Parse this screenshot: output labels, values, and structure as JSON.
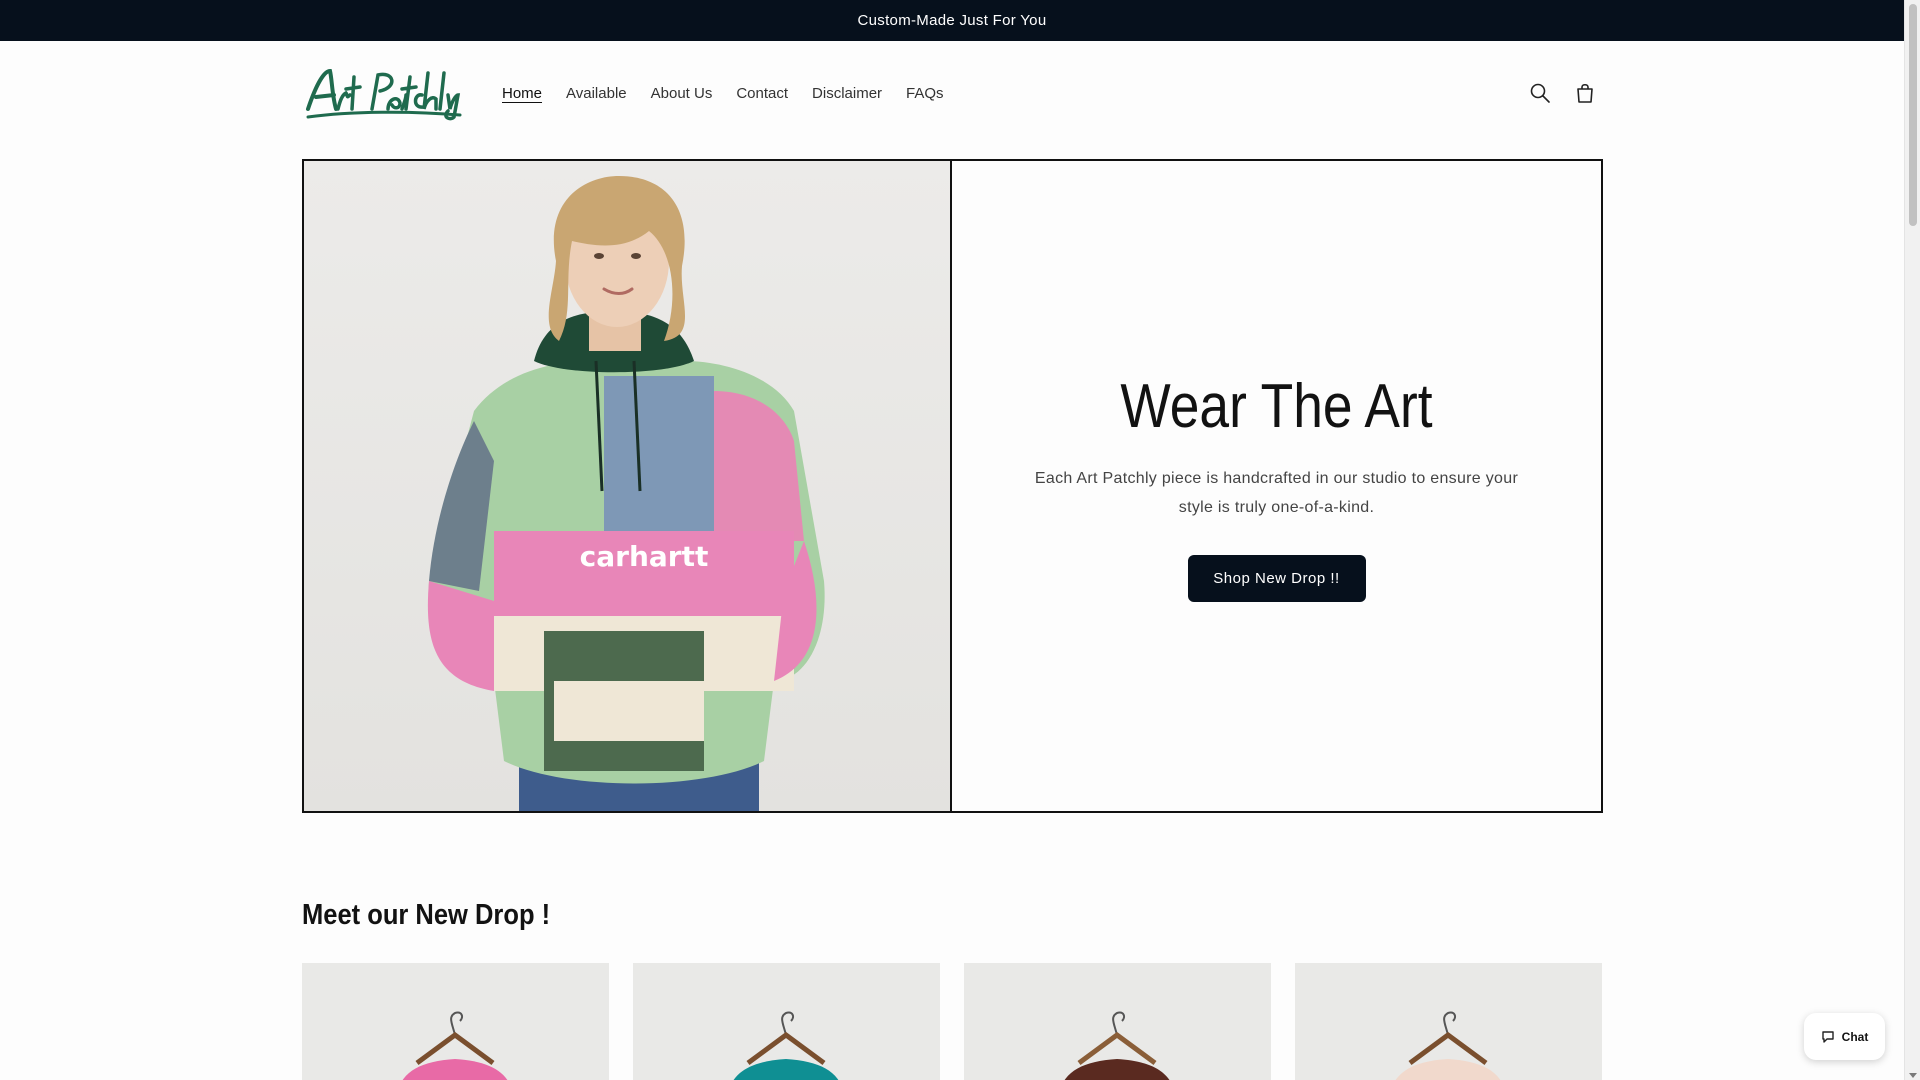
{
  "announcement": "Custom-Made Just For You",
  "brand": {
    "logo_text": "Art Patchly",
    "logo_color": "#1f6b4e"
  },
  "nav": [
    {
      "label": "Home",
      "active": true
    },
    {
      "label": "Available",
      "active": false
    },
    {
      "label": "About Us",
      "active": false
    },
    {
      "label": "Contact",
      "active": false
    },
    {
      "label": "Disclaimer",
      "active": false
    },
    {
      "label": "FAQs",
      "active": false
    }
  ],
  "header_icons": [
    "search-icon",
    "cart-icon"
  ],
  "hero": {
    "image_text": "carhartt",
    "title": "Wear The Art",
    "subtitle": "Each Art Patchly piece is handcrafted in our studio to ensure your style is truly one-of-a-kind.",
    "cta": "Shop New Drop !!"
  },
  "new_drop": {
    "title": "Meet our New Drop !",
    "cards": [
      {
        "color": "#e86aa6"
      },
      {
        "color": "#0f8f93"
      },
      {
        "color": "#5a2a20"
      },
      {
        "color": "#f1d9cc"
      }
    ]
  },
  "chat": {
    "label": "Chat"
  },
  "colors": {
    "dark": "#06101c",
    "background": "#fdfdfd"
  }
}
